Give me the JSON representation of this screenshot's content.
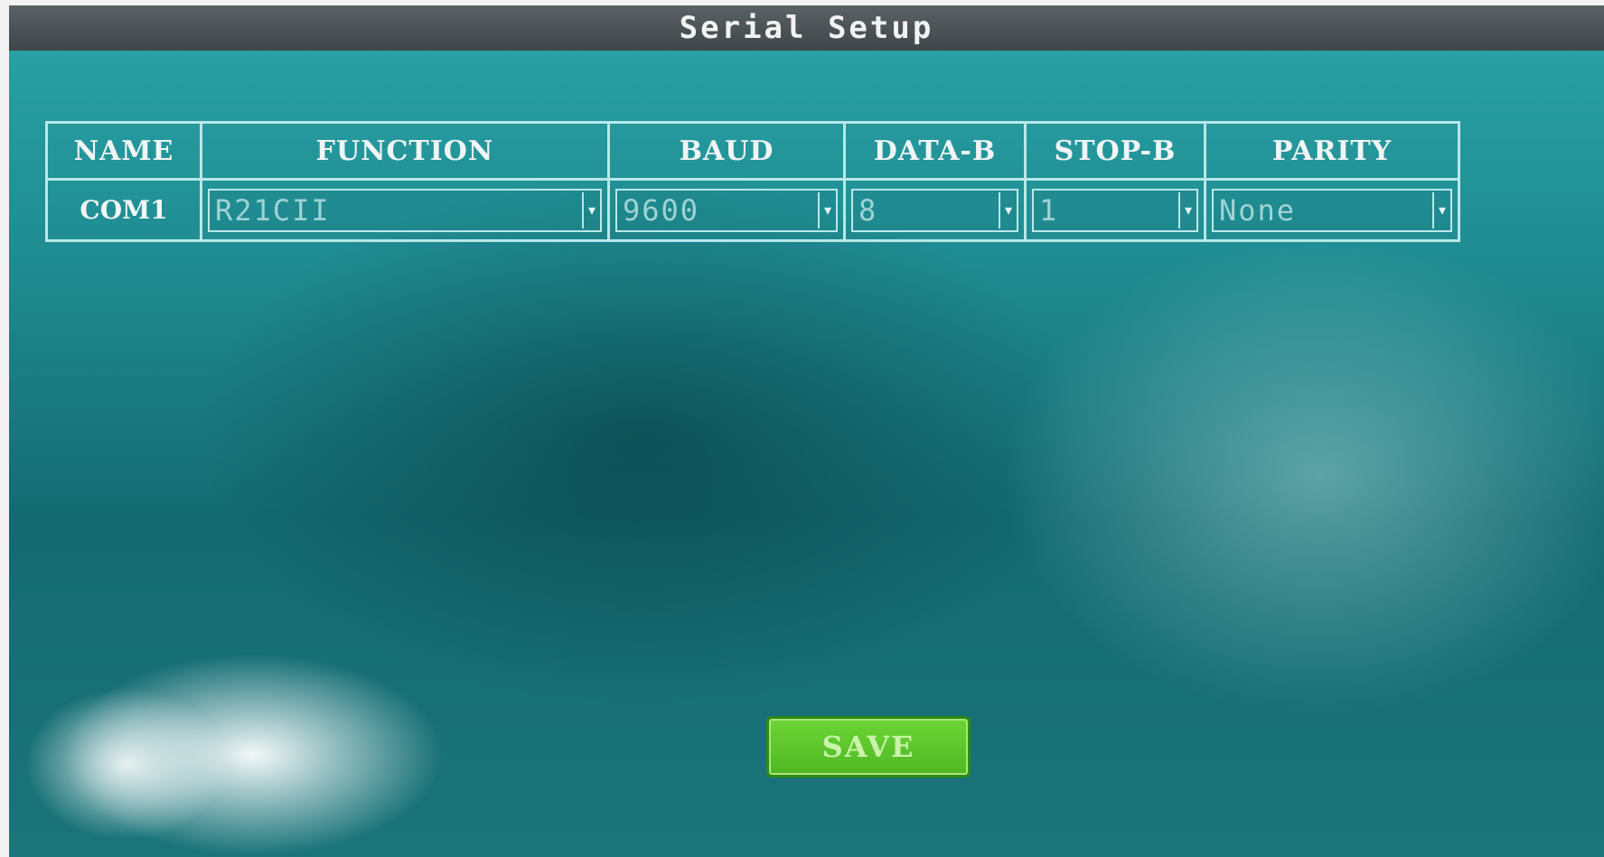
{
  "window": {
    "title": "Serial Setup"
  },
  "table": {
    "headers": {
      "name": "NAME",
      "function": "FUNCTION",
      "baud": "BAUD",
      "data_bits": "DATA-B",
      "stop_bits": "STOP-B",
      "parity": "PARITY"
    },
    "row": {
      "name": "COM1",
      "function": "R21CII",
      "baud": "9600",
      "data_bits": "8",
      "stop_bits": "1",
      "parity": "None"
    }
  },
  "actions": {
    "save_label": "SAVE"
  },
  "colors": {
    "background": "#1f8c91",
    "title_bar": "#4a5155",
    "grid_lines": "#b9e8e8",
    "save_button": "#5cc22b"
  },
  "icons": {
    "dropdown": "chevron-down-icon"
  }
}
